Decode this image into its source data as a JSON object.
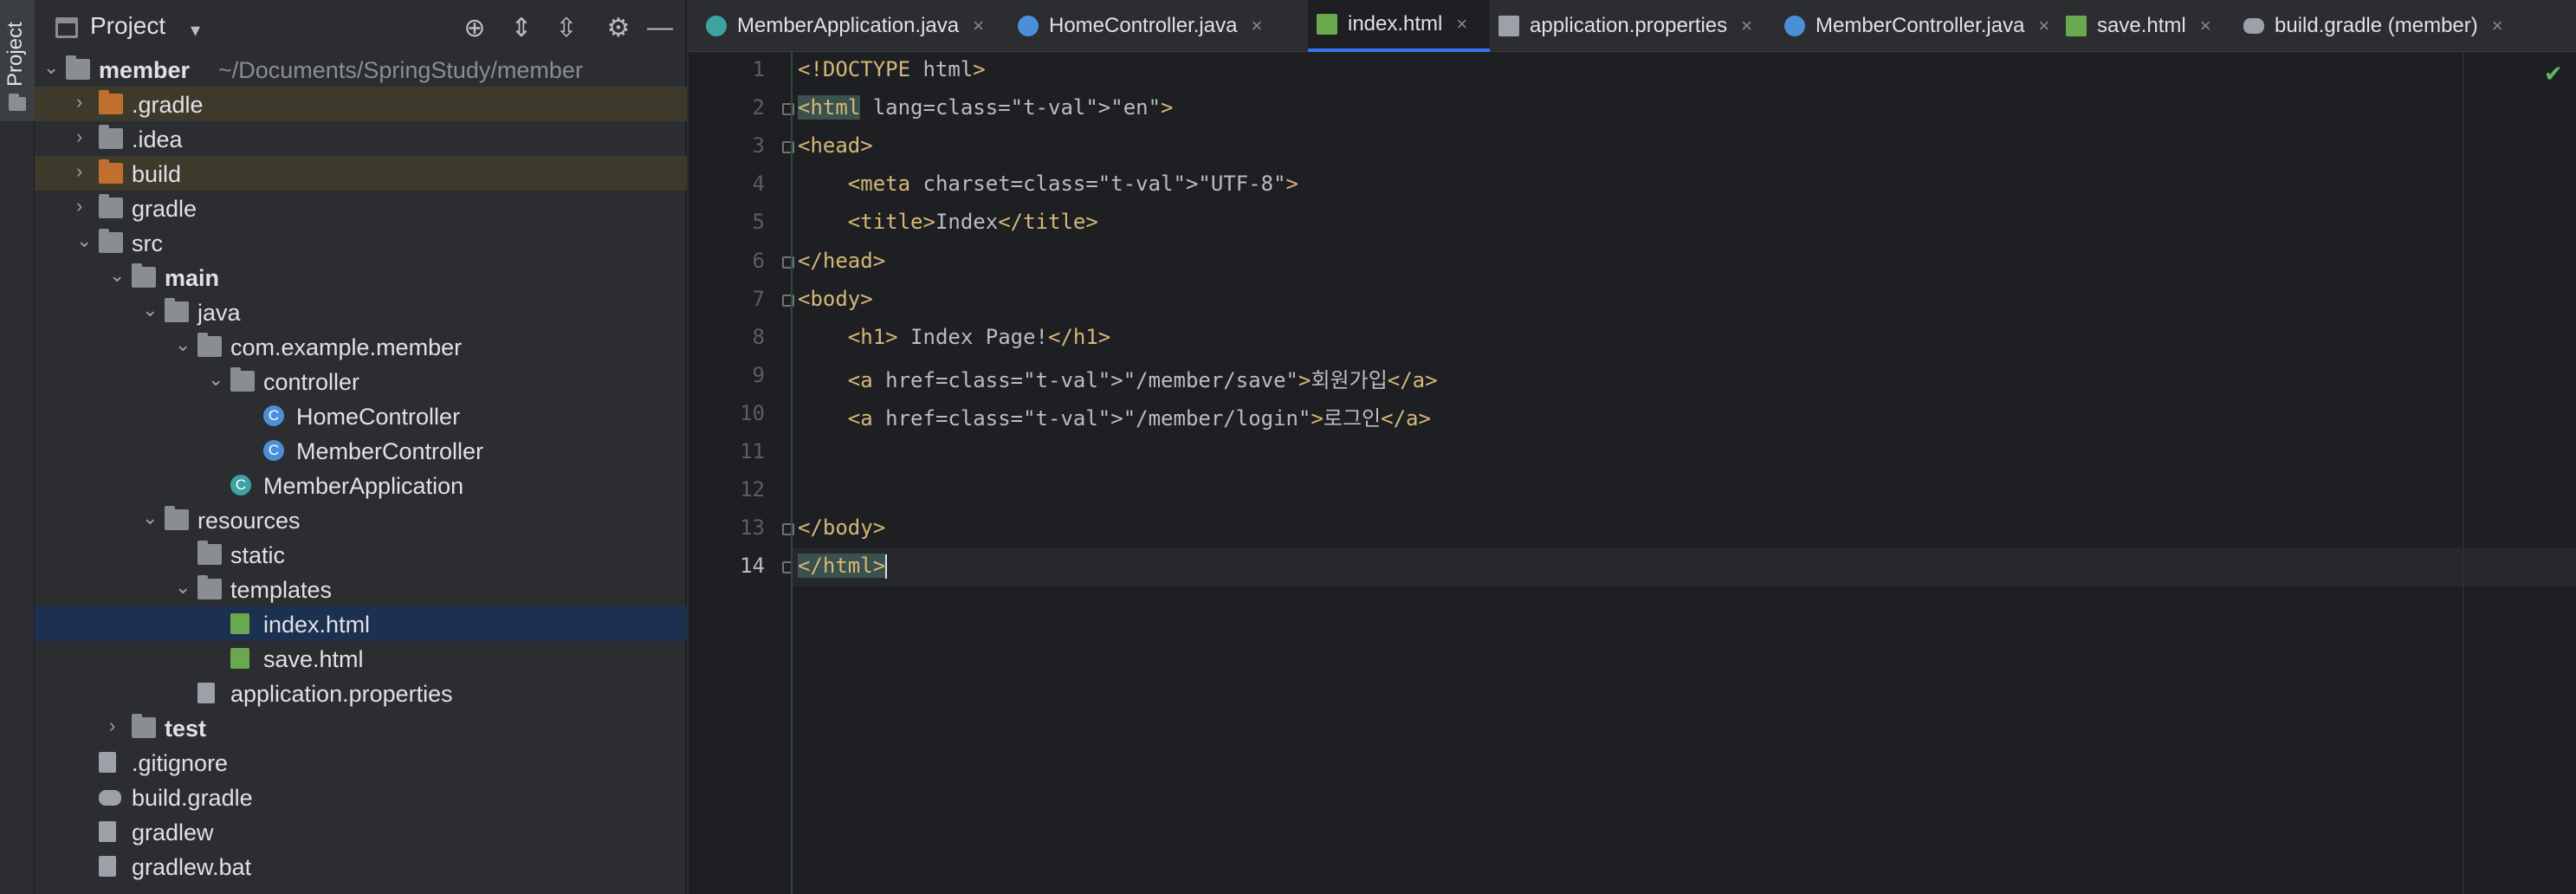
{
  "sidebar_strip": {
    "tab_label": "Project"
  },
  "project_panel": {
    "title": "Project",
    "tree": [
      {
        "label": "member",
        "sub": "~/Documents/SpringStudy/member",
        "depth": 0,
        "expanded": true,
        "icon": "module-folder-icon",
        "bold": true
      },
      {
        "label": ".gradle",
        "depth": 1,
        "expanded": false,
        "icon": "folder-orange-icon",
        "ignored": true
      },
      {
        "label": ".idea",
        "depth": 1,
        "expanded": false,
        "icon": "folder-icon"
      },
      {
        "label": "build",
        "depth": 1,
        "expanded": false,
        "icon": "folder-orange-icon",
        "ignored": true
      },
      {
        "label": "gradle",
        "depth": 1,
        "expanded": false,
        "icon": "folder-icon"
      },
      {
        "label": "src",
        "depth": 1,
        "expanded": true,
        "icon": "folder-icon"
      },
      {
        "label": "main",
        "depth": 2,
        "expanded": true,
        "icon": "source-folder-icon",
        "bold": true
      },
      {
        "label": "java",
        "depth": 3,
        "expanded": true,
        "icon": "source-root-icon"
      },
      {
        "label": "com.example.member",
        "depth": 4,
        "expanded": true,
        "icon": "package-icon"
      },
      {
        "label": "controller",
        "depth": 5,
        "expanded": true,
        "icon": "package-icon"
      },
      {
        "label": "HomeController",
        "depth": 6,
        "icon": "class-icon"
      },
      {
        "label": "MemberController",
        "depth": 6,
        "icon": "class-icon"
      },
      {
        "label": "MemberApplication",
        "depth": 5,
        "icon": "spring-app-icon"
      },
      {
        "label": "resources",
        "depth": 3,
        "expanded": true,
        "icon": "resources-folder-icon"
      },
      {
        "label": "static",
        "depth": 4,
        "icon": "folder-icon"
      },
      {
        "label": "templates",
        "depth": 4,
        "expanded": true,
        "icon": "folder-icon"
      },
      {
        "label": "index.html",
        "depth": 5,
        "icon": "html-file-icon",
        "selected": true
      },
      {
        "label": "save.html",
        "depth": 5,
        "icon": "html-file-icon"
      },
      {
        "label": "application.properties",
        "depth": 4,
        "icon": "properties-file-icon"
      },
      {
        "label": "test",
        "depth": 2,
        "expanded": false,
        "icon": "source-folder-icon",
        "bold": true
      },
      {
        "label": ".gitignore",
        "depth": 1,
        "icon": "gitignore-file-icon"
      },
      {
        "label": "build.gradle",
        "depth": 1,
        "icon": "gradle-file-icon"
      },
      {
        "label": "gradlew",
        "depth": 1,
        "icon": "file-icon"
      },
      {
        "label": "gradlew.bat",
        "depth": 1,
        "icon": "file-icon"
      }
    ]
  },
  "tabs": [
    {
      "label": "MemberApplication.java",
      "icon": "spring-app-icon"
    },
    {
      "label": "HomeController.java",
      "icon": "class-icon"
    },
    {
      "label": "index.html",
      "icon": "html-file-icon",
      "active": true
    },
    {
      "label": "application.properties",
      "icon": "properties-file-icon"
    },
    {
      "label": "MemberController.java",
      "icon": "class-icon"
    },
    {
      "label": "save.html",
      "icon": "html-file-icon"
    },
    {
      "label": "build.gradle (member)",
      "icon": "gradle-file-icon"
    }
  ],
  "editor": {
    "line_numbers": [
      "1",
      "2",
      "3",
      "4",
      "5",
      "6",
      "7",
      "8",
      "9",
      "10",
      "11",
      "12",
      "13",
      "14"
    ],
    "current_line": 14,
    "lines": [
      "<!DOCTYPE html>",
      "<html lang=\"en\">",
      "<head>",
      "    <meta charset=\"UTF-8\">",
      "    <title>Index</title>",
      "</head>",
      "<body>",
      "    <h1> Index Page!</h1>",
      "    <a href=\"/member/save\">회원가입</a>",
      "    <a href=\"/member/login\">로그인</a>",
      "",
      "",
      "</body>",
      "</html>"
    ],
    "status_icon": "analysis-ok-check-icon"
  },
  "colors": {
    "tag": "#d5b778",
    "attr_value": "#6aab73",
    "selection": "#1c3150",
    "accent": "#3574f0"
  }
}
